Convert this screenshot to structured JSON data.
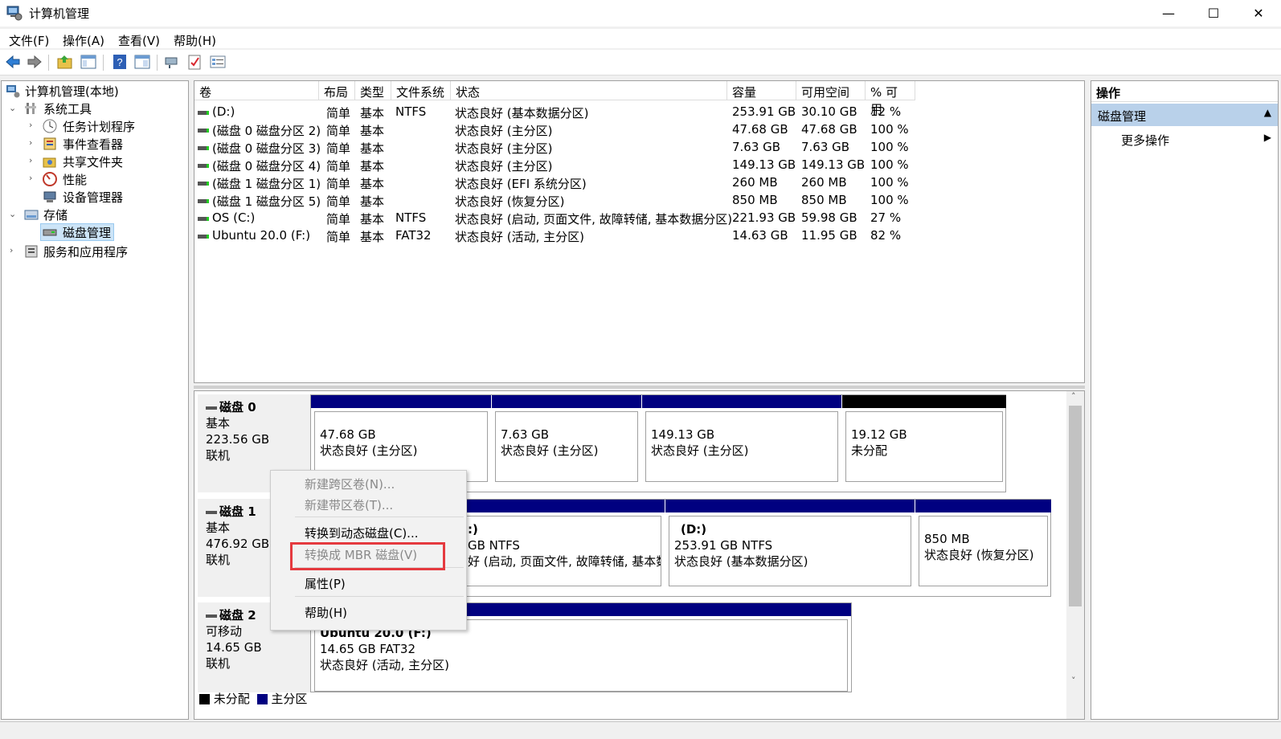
{
  "window": {
    "title": "计算机管理",
    "minimize": "—",
    "maximize": "☐",
    "close": "✕"
  },
  "menu": [
    "文件(F)",
    "操作(A)",
    "查看(V)",
    "帮助(H)"
  ],
  "toolbar": [
    "back-icon",
    "forward-icon",
    "up-folder-icon",
    "show-hide-tree-icon",
    "help-icon",
    "properties-icon",
    "connect-icon",
    "check-icon",
    "details-icon"
  ],
  "tree": {
    "root": "计算机管理(本地)",
    "system_tools": "系统工具",
    "task_scheduler": "任务计划程序",
    "event_viewer": "事件查看器",
    "shared_folders": "共享文件夹",
    "performance": "性能",
    "device_manager": "设备管理器",
    "storage": "存储",
    "disk_management": "磁盘管理",
    "services_apps": "服务和应用程序"
  },
  "table": {
    "headers": [
      "卷",
      "布局",
      "类型",
      "文件系统",
      "状态",
      "容量",
      "可用空间",
      "% 可用"
    ],
    "rows": [
      [
        "(D:)",
        "简单",
        "基本",
        "NTFS",
        "状态良好 (基本数据分区)",
        "253.91 GB",
        "30.10 GB",
        "12 %"
      ],
      [
        "(磁盘 0 磁盘分区 2)",
        "简单",
        "基本",
        "",
        "状态良好 (主分区)",
        "47.68 GB",
        "47.68 GB",
        "100 %"
      ],
      [
        "(磁盘 0 磁盘分区 3)",
        "简单",
        "基本",
        "",
        "状态良好 (主分区)",
        "7.63 GB",
        "7.63 GB",
        "100 %"
      ],
      [
        "(磁盘 0 磁盘分区 4)",
        "简单",
        "基本",
        "",
        "状态良好 (主分区)",
        "149.13 GB",
        "149.13 GB",
        "100 %"
      ],
      [
        "(磁盘 1 磁盘分区 1)",
        "简单",
        "基本",
        "",
        "状态良好 (EFI 系统分区)",
        "260 MB",
        "260 MB",
        "100 %"
      ],
      [
        "(磁盘 1 磁盘分区 5)",
        "简单",
        "基本",
        "",
        "状态良好 (恢复分区)",
        "850 MB",
        "850 MB",
        "100 %"
      ],
      [
        "OS (C:)",
        "简单",
        "基本",
        "NTFS",
        "状态良好 (启动, 页面文件, 故障转储, 基本数据分区)",
        "221.93 GB",
        "59.98 GB",
        "27 %"
      ],
      [
        "Ubuntu 20.0 (F:)",
        "简单",
        "基本",
        "FAT32",
        "状态良好 (活动, 主分区)",
        "14.63 GB",
        "11.95 GB",
        "82 %"
      ]
    ]
  },
  "disks": [
    {
      "name": "磁盘 0",
      "type": "基本",
      "size": "223.56 GB",
      "state": "联机",
      "partitions": [
        {
          "line1": "47.68 GB",
          "line2": "状态良好 (主分区)"
        },
        {
          "line1": "7.63 GB",
          "line2": "状态良好 (主分区)"
        },
        {
          "line1": "149.13 GB",
          "line2": "状态良好 (主分区)"
        },
        {
          "line1": "19.12 GB",
          "line2": "未分配"
        }
      ]
    },
    {
      "name": "磁盘 1",
      "type": "基本",
      "size": "476.92 GB",
      "state": "联机",
      "partitions": [
        {
          "title": ":)",
          "line1": "GB NTFS",
          "line2": "好 (启动, 页面文件, 故障转储, 基本数"
        },
        {
          "title": "(D:)",
          "line1": "253.91 GB NTFS",
          "line2": "状态良好 (基本数据分区)"
        },
        {
          "line1": "850 MB",
          "line2": "状态良好 (恢复分区)"
        }
      ]
    },
    {
      "name": "磁盘 2",
      "type": "可移动",
      "size": "14.65 GB",
      "state": "联机",
      "partitions": [
        {
          "title": "Ubuntu 20.0  (F:)",
          "line1": "14.65 GB FAT32",
          "line2": "状态良好 (活动, 主分区)"
        }
      ]
    }
  ],
  "legend": {
    "unallocated": "未分配",
    "primary": "主分区"
  },
  "context_menu": {
    "new_spanned": "新建跨区卷(N)...",
    "new_striped": "新建带区卷(T)...",
    "convert_dynamic": "转换到动态磁盘(C)...",
    "convert_mbr": "转换成 MBR 磁盘(V)",
    "properties": "属性(P)",
    "help": "帮助(H)"
  },
  "actions": {
    "header": "操作",
    "section": "磁盘管理",
    "more": "更多操作"
  },
  "colors": {
    "primary_partition": "#000080",
    "unallocated": "#000000",
    "highlight": "#e53a3f",
    "selection": "#cce4f7"
  }
}
